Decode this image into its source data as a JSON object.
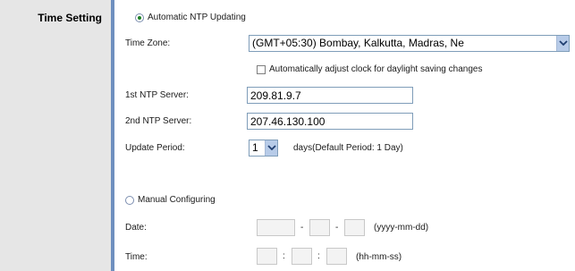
{
  "section": {
    "title": "Time Setting"
  },
  "ntp": {
    "auto_label": "Automatic NTP Updating",
    "timezone_label": "Time Zone:",
    "timezone_value": "(GMT+05:30) Bombay, Kalkutta, Madras, Ne",
    "daylight_label": "Automatically adjust clock for daylight saving changes",
    "server1_label": "1st NTP Server:",
    "server1_value": "209.81.9.7",
    "server2_label": "2nd NTP Server:",
    "server2_value": "207.46.130.100",
    "update_period_label": "Update Period:",
    "update_period_value": "1",
    "update_period_hint": "days(Default Period: 1 Day)",
    "auto_selected": true,
    "daylight_checked": false
  },
  "manual": {
    "label": "Manual Configuring",
    "date_label": "Date:",
    "date_separator": "-",
    "date_format": "(yyyy-mm-dd)",
    "time_label": "Time:",
    "time_separator": ":",
    "time_format": "(hh-mm-ss)",
    "selected": false
  },
  "icons": {
    "radio_selected": "radio-selected-icon",
    "radio_unselected": "radio-unselected-icon",
    "dropdown": "chevron-down-icon",
    "checkbox": "checkbox-icon"
  },
  "colors": {
    "left_panel": "#e6e6e6",
    "divider": "#6f8fbf",
    "radio_dot": "#1c7f24",
    "input_border": "#7f9db9",
    "dropdown_button": "#b7cbe8"
  }
}
